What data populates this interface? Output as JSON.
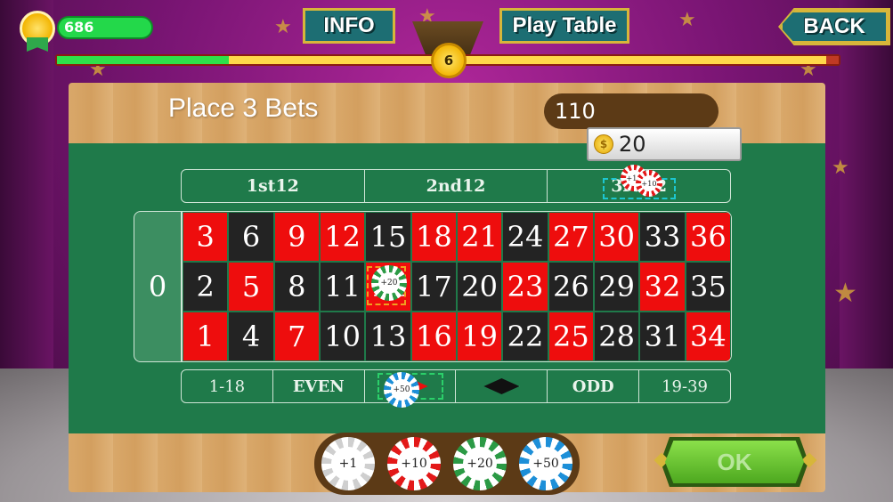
{
  "hud": {
    "coins": "686",
    "level": "6",
    "level_progress": 0.22,
    "buttons": {
      "info": "INFO",
      "play_table": "Play Table",
      "back": "BACK"
    }
  },
  "board": {
    "title": "Place 3 Bets",
    "total_bet": "110",
    "selected_chip_value": "20",
    "dozens": [
      "1st12",
      "2nd12",
      "3rd12"
    ],
    "zero": "0",
    "rows": [
      [
        {
          "n": "3",
          "c": "red"
        },
        {
          "n": "6",
          "c": "black"
        },
        {
          "n": "9",
          "c": "red"
        },
        {
          "n": "12",
          "c": "red"
        },
        {
          "n": "15",
          "c": "black"
        },
        {
          "n": "18",
          "c": "red"
        },
        {
          "n": "21",
          "c": "red"
        },
        {
          "n": "24",
          "c": "black"
        },
        {
          "n": "27",
          "c": "red"
        },
        {
          "n": "30",
          "c": "red"
        },
        {
          "n": "33",
          "c": "black"
        },
        {
          "n": "36",
          "c": "red"
        }
      ],
      [
        {
          "n": "2",
          "c": "black"
        },
        {
          "n": "5",
          "c": "red"
        },
        {
          "n": "8",
          "c": "black"
        },
        {
          "n": "11",
          "c": "black"
        },
        {
          "n": "14",
          "c": "red"
        },
        {
          "n": "17",
          "c": "black"
        },
        {
          "n": "20",
          "c": "black"
        },
        {
          "n": "23",
          "c": "red"
        },
        {
          "n": "26",
          "c": "black"
        },
        {
          "n": "29",
          "c": "black"
        },
        {
          "n": "32",
          "c": "red"
        },
        {
          "n": "35",
          "c": "black"
        }
      ],
      [
        {
          "n": "1",
          "c": "red"
        },
        {
          "n": "4",
          "c": "black"
        },
        {
          "n": "7",
          "c": "red"
        },
        {
          "n": "10",
          "c": "black"
        },
        {
          "n": "13",
          "c": "black"
        },
        {
          "n": "16",
          "c": "red"
        },
        {
          "n": "19",
          "c": "red"
        },
        {
          "n": "22",
          "c": "black"
        },
        {
          "n": "25",
          "c": "red"
        },
        {
          "n": "28",
          "c": "black"
        },
        {
          "n": "31",
          "c": "black"
        },
        {
          "n": "34",
          "c": "red"
        }
      ]
    ],
    "outside": [
      "1-18",
      "EVEN",
      "red-diamond",
      "black-diamond",
      "ODD",
      "19-39"
    ],
    "placed_chips": [
      {
        "label": "+10",
        "color": "red",
        "on": "3rd12"
      },
      {
        "label": "+10",
        "color": "red",
        "on": "3rd12"
      },
      {
        "label": "+20",
        "color": "green",
        "on": "14"
      },
      {
        "label": "+50",
        "color": "blue",
        "on": "red"
      }
    ]
  },
  "chip_selector": [
    {
      "label": "+1",
      "color": "white"
    },
    {
      "label": "+10",
      "color": "red"
    },
    {
      "label": "+20",
      "color": "green"
    },
    {
      "label": "+50",
      "color": "blue"
    }
  ],
  "ok_label": "OK"
}
